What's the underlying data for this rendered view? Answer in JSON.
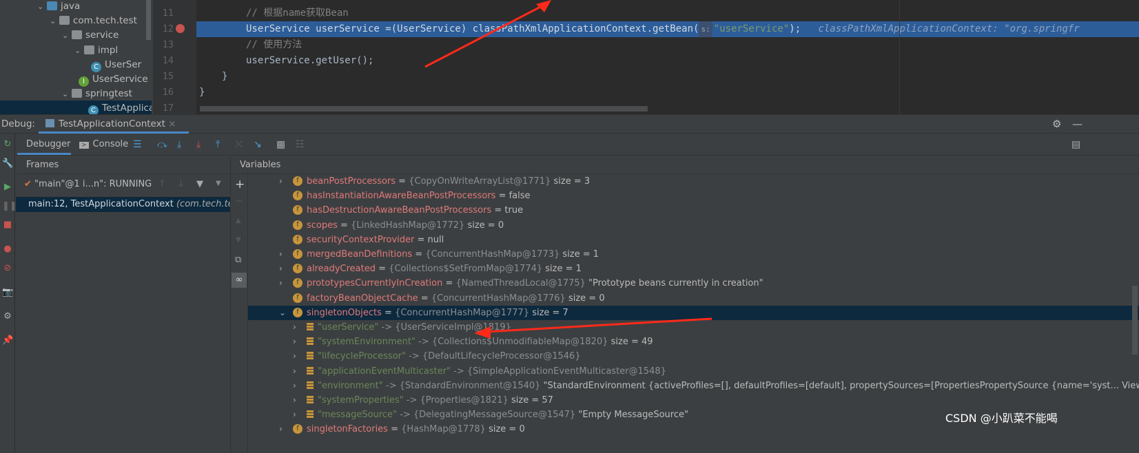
{
  "project_tree": [
    {
      "label": "java",
      "icon": "folder-icon",
      "indent": 60,
      "expanded": true
    },
    {
      "label": "com.tech.test",
      "icon": "package-icon",
      "indent": 78,
      "expanded": true
    },
    {
      "label": "service",
      "icon": "package-icon",
      "indent": 96,
      "expanded": true
    },
    {
      "label": "impl",
      "icon": "package-icon",
      "indent": 114,
      "expanded": true
    },
    {
      "label": "UserSer",
      "icon": "class-icon",
      "indent": 138,
      "expanded": null
    },
    {
      "label": "UserService",
      "icon": "interface-icon",
      "indent": 120,
      "expanded": null
    },
    {
      "label": "springtest",
      "icon": "package-icon",
      "indent": 96,
      "expanded": true
    },
    {
      "label": "TestApplica",
      "icon": "class-icon",
      "indent": 120,
      "expanded": null
    }
  ],
  "editor": {
    "line_numbers": [
      "11",
      "12",
      "13",
      "14",
      "15",
      "16",
      "17"
    ],
    "line11": "// 根据name获取Bean",
    "line12_code": "UserService userService =(UserService) classPathXmlApplicationContext.getBean(",
    "line12_param_hint": "s:",
    "line12_string": "\"userService\"",
    "line12_end": ");",
    "line12_inline_value": "classPathXmlApplicationContext: \"org.springfr",
    "line13": "// 使用方法",
    "line14": "userService.getUser();",
    "line15": "}",
    "line16": "}"
  },
  "debug": {
    "label": "Debug:",
    "session_tab": "TestApplicationContext",
    "tabs": [
      "Debugger",
      "Console"
    ],
    "frames_title": "Frames",
    "variables_title": "Variables",
    "thread": "\"main\"@1 i...n\": RUNNING",
    "frame": "main:12, TestApplicationContext",
    "frame_pkg": "(com.tech.test"
  },
  "variables": [
    {
      "name": "beanPostProcessors",
      "type": "{CopyOnWriteArrayList@1771}",
      "value": "size = 3",
      "expandable": true,
      "kind": "field"
    },
    {
      "name": "hasInstantiationAwareBeanPostProcessors",
      "type": "",
      "value": "false",
      "expandable": false,
      "kind": "field"
    },
    {
      "name": "hasDestructionAwareBeanPostProcessors",
      "type": "",
      "value": "true",
      "expandable": false,
      "kind": "field"
    },
    {
      "name": "scopes",
      "type": "{LinkedHashMap@1772}",
      "value": "size = 0",
      "expandable": false,
      "kind": "field"
    },
    {
      "name": "securityContextProvider",
      "type": "",
      "value": "null",
      "expandable": false,
      "kind": "field"
    },
    {
      "name": "mergedBeanDefinitions",
      "type": "{ConcurrentHashMap@1773}",
      "value": "size = 1",
      "expandable": true,
      "kind": "field"
    },
    {
      "name": "alreadyCreated",
      "type": "{Collections$SetFromMap@1774}",
      "value": "size = 1",
      "expandable": true,
      "kind": "field"
    },
    {
      "name": "prototypesCurrentlyInCreation",
      "type": "{NamedThreadLocal@1775}",
      "value": "\"Prototype beans currently in creation\"",
      "expandable": true,
      "kind": "field"
    },
    {
      "name": "factoryBeanObjectCache",
      "type": "{ConcurrentHashMap@1776}",
      "value": "size = 0",
      "expandable": false,
      "kind": "field"
    },
    {
      "name": "singletonObjects",
      "type": "{ConcurrentHashMap@1777}",
      "value": "size = 7",
      "expandable": true,
      "expanded": true,
      "selected": true,
      "kind": "field"
    },
    {
      "name": "\"userService\"",
      "type": "-> {UserServiceImpl@1819}",
      "value": "",
      "expandable": true,
      "kind": "entry"
    },
    {
      "name": "\"systemEnvironment\"",
      "type": "-> {Collections$UnmodifiableMap@1820}",
      "value": "size = 49",
      "expandable": true,
      "kind": "entry"
    },
    {
      "name": "\"lifecycleProcessor\"",
      "type": "-> {DefaultLifecycleProcessor@1546}",
      "value": "",
      "expandable": true,
      "kind": "entry"
    },
    {
      "name": "\"applicationEventMulticaster\"",
      "type": "-> {SimpleApplicationEventMulticaster@1548}",
      "value": "",
      "expandable": true,
      "kind": "entry"
    },
    {
      "name": "\"environment\"",
      "type": "-> {StandardEnvironment@1540}",
      "value": "\"StandardEnvironment {activeProfiles=[], defaultProfiles=[default], propertySources=[PropertiesPropertySource {name='syst... View",
      "expandable": true,
      "kind": "entry"
    },
    {
      "name": "\"systemProperties\"",
      "type": "-> {Properties@1821}",
      "value": "size = 57",
      "expandable": true,
      "kind": "entry"
    },
    {
      "name": "\"messageSource\"",
      "type": "-> {DelegatingMessageSource@1547}",
      "value": "\"Empty MessageSource\"",
      "expandable": true,
      "kind": "entry"
    },
    {
      "name": "singletonFactories",
      "type": "{HashMap@1778}",
      "value": "size = 0",
      "expandable": true,
      "kind": "field"
    }
  ],
  "watermark": "CSDN @小趴菜不能喝",
  "colors": {
    "accent": "#4a88c7",
    "selection": "#2d5d99",
    "annotation_arrow": "#ff2a1a"
  }
}
